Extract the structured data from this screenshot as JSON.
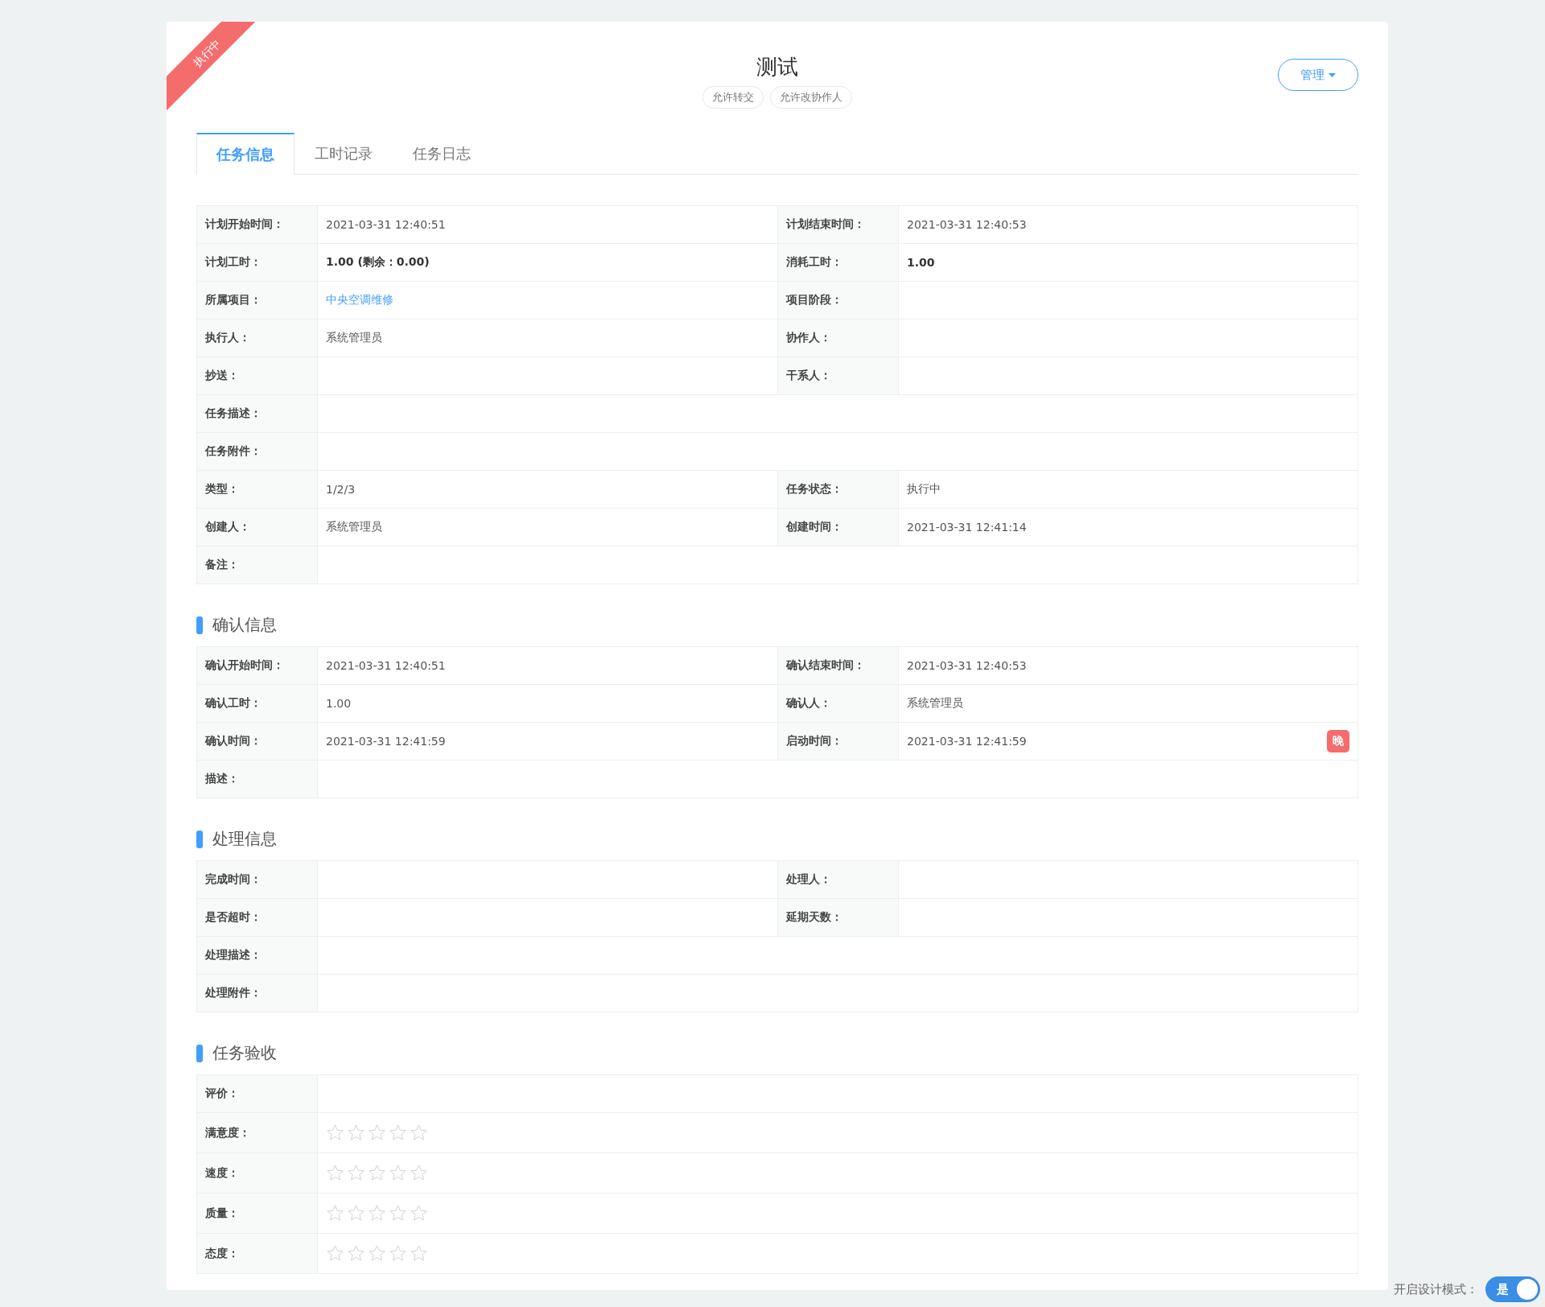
{
  "ribbon": "执行中",
  "title": "测试",
  "tags": [
    "允许转交",
    "允许改协作人"
  ],
  "manage_button": "管理",
  "tabs": [
    {
      "label": "任务信息",
      "selected": true
    },
    {
      "label": "工时记录",
      "selected": false
    },
    {
      "label": "任务日志",
      "selected": false
    }
  ],
  "sections": [
    {
      "rows": [
        [
          {
            "label": "计划开始时间：",
            "value": "2021-03-31 12:40:51"
          },
          {
            "label": "计划结束时间：",
            "value": "2021-03-31 12:40:53"
          }
        ],
        [
          {
            "label": "计划工时：",
            "value": "1.00 (剩余：0.00)",
            "kind": "bold"
          },
          {
            "label": "消耗工时：",
            "value": "1.00",
            "kind": "bold"
          }
        ],
        [
          {
            "label": "所属项目：",
            "value": "中央空调维修",
            "kind": "link"
          },
          {
            "label": "项目阶段："
          }
        ],
        [
          {
            "label": "执行人：",
            "value": "系统管理员"
          },
          {
            "label": "协作人："
          }
        ],
        [
          {
            "label": "抄送："
          },
          {
            "label": "干系人："
          }
        ],
        [
          {
            "label": "任务描述："
          }
        ],
        [
          {
            "label": "任务附件："
          }
        ],
        [
          {
            "label": "类型：",
            "value": "1/2/3"
          },
          {
            "label": "任务状态：",
            "value": "执行中"
          }
        ],
        [
          {
            "label": "创建人：",
            "value": "系统管理员"
          },
          {
            "label": "创建时间：",
            "value": "2021-03-31 12:41:14"
          }
        ],
        [
          {
            "label": "备注："
          }
        ]
      ]
    },
    {
      "heading": "确认信息",
      "rows": [
        [
          {
            "label": "确认开始时间：",
            "value": "2021-03-31 12:40:51"
          },
          {
            "label": "确认结束时间：",
            "value": "2021-03-31 12:40:53"
          }
        ],
        [
          {
            "label": "确认工时：",
            "value": "1.00"
          },
          {
            "label": "确认人：",
            "value": "系统管理员"
          }
        ],
        [
          {
            "label": "确认时间：",
            "value": "2021-03-31 12:41:59"
          },
          {
            "label": "启动时间：",
            "value": "2021-03-31 12:41:59",
            "badge": "晚"
          }
        ],
        [
          {
            "label": "描述："
          }
        ]
      ]
    },
    {
      "heading": "处理信息",
      "rows": [
        [
          {
            "label": "完成时间："
          },
          {
            "label": "处理人："
          }
        ],
        [
          {
            "label": "是否超时："
          },
          {
            "label": "延期天数："
          }
        ],
        [
          {
            "label": "处理描述："
          }
        ],
        [
          {
            "label": "处理附件："
          }
        ]
      ]
    },
    {
      "heading": "任务验收",
      "rows": [
        [
          {
            "label": "评价："
          }
        ],
        [
          {
            "label": "满意度：",
            "kind": "stars",
            "stars": 0
          }
        ],
        [
          {
            "label": "速度：",
            "kind": "stars",
            "stars": 0
          }
        ],
        [
          {
            "label": "质量：",
            "kind": "stars",
            "stars": 0
          }
        ],
        [
          {
            "label": "态度：",
            "kind": "stars",
            "stars": 0
          }
        ]
      ]
    }
  ],
  "design_mode": {
    "label": "开启设计模式：",
    "on": true,
    "text": "是"
  }
}
